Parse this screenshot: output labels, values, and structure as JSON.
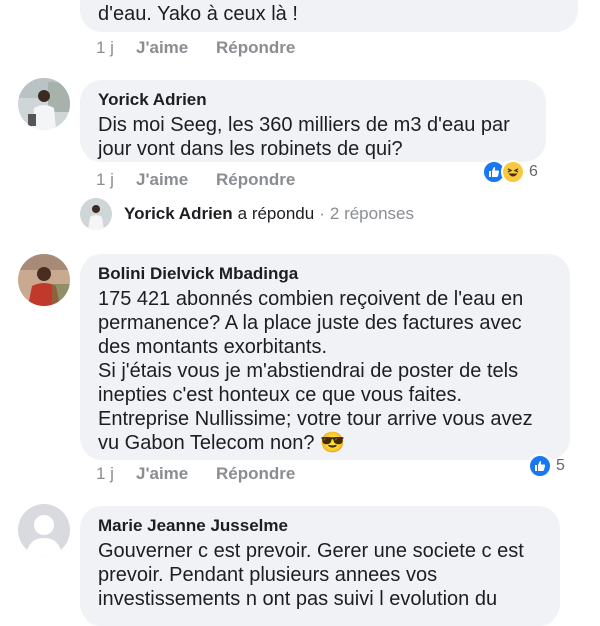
{
  "comment0": {
    "text": "d'eau. Yako à ceux là !",
    "time": "1 j",
    "like": "J'aime",
    "reply": "Répondre"
  },
  "comment1": {
    "author": "Yorick Adrien",
    "text": "Dis moi Seeg, les 360 milliers de m3 d'eau par jour vont dans les robinets de qui?",
    "time": "1 j",
    "like": "J'aime",
    "reply": "Répondre",
    "reaction_count": "6",
    "reactions": [
      "like-icon",
      "haha-icon"
    ]
  },
  "reply_thread": {
    "author": "Yorick Adrien",
    "action": "a répondu",
    "separator": "·",
    "count": "2 réponses"
  },
  "comment2": {
    "author": "Bolini Dielvick Mbadinga",
    "text": "175 421 abonnés combien reçoivent de l'eau en permanence? A la place juste des factures avec des montants exorbitants.\nSi j'étais vous je m'abstiendrai de poster de tels inepties c'est honteux ce que vous faites.\nEntreprise Nullissime; votre tour arrive vous avez vu Gabon Telecom non?",
    "emoji": "😎",
    "time": "1 j",
    "like": "J'aime",
    "reply": "Répondre",
    "reaction_count": "5",
    "reactions": [
      "like-icon"
    ]
  },
  "comment3": {
    "author": "Marie Jeanne Jusselme",
    "text": "Gouverner c est prevoir. Gerer une societe c est prevoir. Pendant plusieurs annees vos investissements n ont pas suivi l evolution du"
  }
}
